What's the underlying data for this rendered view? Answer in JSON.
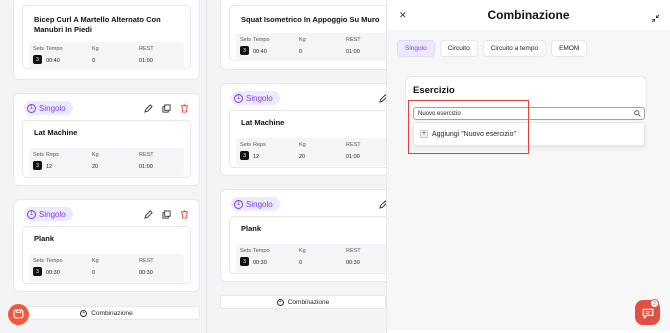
{
  "colors": {
    "accent": "#7c3aed",
    "accent_bg": "#ede9fe",
    "delete": "#e53e3e",
    "highlight": "#e53e3e",
    "chat": "#e05043"
  },
  "columns": [
    {
      "groups": [
        {
          "type_label": null,
          "exercise": {
            "title": "Bicep Curl A Martello Alternato Con Manubri In Piedi",
            "headers": [
              "Sets",
              "Tempo",
              "Kg",
              "REST"
            ],
            "values": [
              "3",
              "00:40",
              "0",
              "01:00"
            ]
          }
        },
        {
          "type_label": "Singolo",
          "exercise": {
            "title": "Lat Machine",
            "headers": [
              "Sets",
              "Reps",
              "Kg",
              "REST"
            ],
            "values": [
              "3",
              "12",
              "20",
              "01:00"
            ]
          }
        },
        {
          "type_label": "Singolo",
          "exercise": {
            "title": "Plank",
            "headers": [
              "Sets",
              "Tempo",
              "Kg",
              "REST"
            ],
            "values": [
              "3",
              "00:30",
              "0",
              "00:30"
            ]
          }
        }
      ],
      "combo_label": "Combinazione"
    },
    {
      "groups": [
        {
          "type_label": null,
          "exercise": {
            "title": "Squat Isometrico In Appoggio Su Muro",
            "headers": [
              "Sets",
              "Tempo",
              "Kg",
              "REST"
            ],
            "values": [
              "3",
              "00:40",
              "0",
              "01:00"
            ]
          }
        },
        {
          "type_label": "Singolo",
          "exercise": {
            "title": "Lat Machine",
            "headers": [
              "Sets",
              "Reps",
              "Kg",
              "REST"
            ],
            "values": [
              "3",
              "12",
              "20",
              "01:00"
            ]
          }
        },
        {
          "type_label": "Singolo",
          "exercise": {
            "title": "Plank",
            "headers": [
              "Sets",
              "Tempo",
              "Kg",
              "REST"
            ],
            "values": [
              "3",
              "00:30",
              "0",
              "00:30"
            ]
          }
        }
      ],
      "combo_label": "Combinazione"
    }
  ],
  "panel": {
    "title": "Combinazione",
    "tabs": [
      "Singolo",
      "Circuito",
      "Circuito a tempo",
      "EMOM"
    ],
    "active_tab": "Singolo",
    "section_title": "Esercizio",
    "search_value": "Nuovo esercizio",
    "add_option": "Aggiungi \"Nuovo esercizio\""
  },
  "chat_badge_count": "2"
}
